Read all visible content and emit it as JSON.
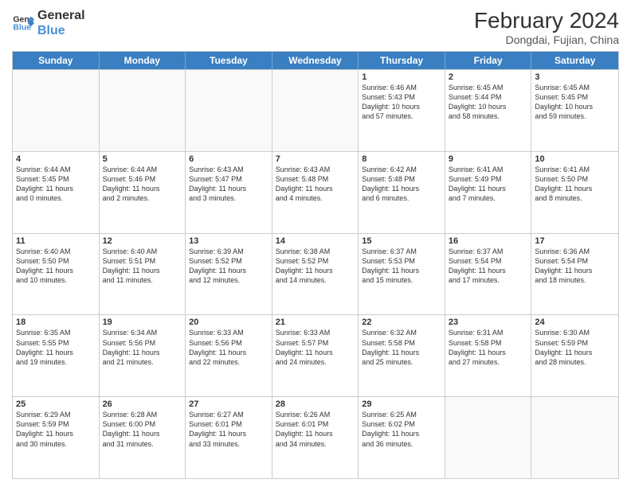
{
  "header": {
    "logo_line1": "General",
    "logo_line2": "Blue",
    "month_year": "February 2024",
    "location": "Dongdai, Fujian, China"
  },
  "weekdays": [
    "Sunday",
    "Monday",
    "Tuesday",
    "Wednesday",
    "Thursday",
    "Friday",
    "Saturday"
  ],
  "rows": [
    [
      {
        "day": "",
        "info": ""
      },
      {
        "day": "",
        "info": ""
      },
      {
        "day": "",
        "info": ""
      },
      {
        "day": "",
        "info": ""
      },
      {
        "day": "1",
        "info": "Sunrise: 6:46 AM\nSunset: 5:43 PM\nDaylight: 10 hours\nand 57 minutes."
      },
      {
        "day": "2",
        "info": "Sunrise: 6:45 AM\nSunset: 5:44 PM\nDaylight: 10 hours\nand 58 minutes."
      },
      {
        "day": "3",
        "info": "Sunrise: 6:45 AM\nSunset: 5:45 PM\nDaylight: 10 hours\nand 59 minutes."
      }
    ],
    [
      {
        "day": "4",
        "info": "Sunrise: 6:44 AM\nSunset: 5:45 PM\nDaylight: 11 hours\nand 0 minutes."
      },
      {
        "day": "5",
        "info": "Sunrise: 6:44 AM\nSunset: 5:46 PM\nDaylight: 11 hours\nand 2 minutes."
      },
      {
        "day": "6",
        "info": "Sunrise: 6:43 AM\nSunset: 5:47 PM\nDaylight: 11 hours\nand 3 minutes."
      },
      {
        "day": "7",
        "info": "Sunrise: 6:43 AM\nSunset: 5:48 PM\nDaylight: 11 hours\nand 4 minutes."
      },
      {
        "day": "8",
        "info": "Sunrise: 6:42 AM\nSunset: 5:48 PM\nDaylight: 11 hours\nand 6 minutes."
      },
      {
        "day": "9",
        "info": "Sunrise: 6:41 AM\nSunset: 5:49 PM\nDaylight: 11 hours\nand 7 minutes."
      },
      {
        "day": "10",
        "info": "Sunrise: 6:41 AM\nSunset: 5:50 PM\nDaylight: 11 hours\nand 8 minutes."
      }
    ],
    [
      {
        "day": "11",
        "info": "Sunrise: 6:40 AM\nSunset: 5:50 PM\nDaylight: 11 hours\nand 10 minutes."
      },
      {
        "day": "12",
        "info": "Sunrise: 6:40 AM\nSunset: 5:51 PM\nDaylight: 11 hours\nand 11 minutes."
      },
      {
        "day": "13",
        "info": "Sunrise: 6:39 AM\nSunset: 5:52 PM\nDaylight: 11 hours\nand 12 minutes."
      },
      {
        "day": "14",
        "info": "Sunrise: 6:38 AM\nSunset: 5:52 PM\nDaylight: 11 hours\nand 14 minutes."
      },
      {
        "day": "15",
        "info": "Sunrise: 6:37 AM\nSunset: 5:53 PM\nDaylight: 11 hours\nand 15 minutes."
      },
      {
        "day": "16",
        "info": "Sunrise: 6:37 AM\nSunset: 5:54 PM\nDaylight: 11 hours\nand 17 minutes."
      },
      {
        "day": "17",
        "info": "Sunrise: 6:36 AM\nSunset: 5:54 PM\nDaylight: 11 hours\nand 18 minutes."
      }
    ],
    [
      {
        "day": "18",
        "info": "Sunrise: 6:35 AM\nSunset: 5:55 PM\nDaylight: 11 hours\nand 19 minutes."
      },
      {
        "day": "19",
        "info": "Sunrise: 6:34 AM\nSunset: 5:56 PM\nDaylight: 11 hours\nand 21 minutes."
      },
      {
        "day": "20",
        "info": "Sunrise: 6:33 AM\nSunset: 5:56 PM\nDaylight: 11 hours\nand 22 minutes."
      },
      {
        "day": "21",
        "info": "Sunrise: 6:33 AM\nSunset: 5:57 PM\nDaylight: 11 hours\nand 24 minutes."
      },
      {
        "day": "22",
        "info": "Sunrise: 6:32 AM\nSunset: 5:58 PM\nDaylight: 11 hours\nand 25 minutes."
      },
      {
        "day": "23",
        "info": "Sunrise: 6:31 AM\nSunset: 5:58 PM\nDaylight: 11 hours\nand 27 minutes."
      },
      {
        "day": "24",
        "info": "Sunrise: 6:30 AM\nSunset: 5:59 PM\nDaylight: 11 hours\nand 28 minutes."
      }
    ],
    [
      {
        "day": "25",
        "info": "Sunrise: 6:29 AM\nSunset: 5:59 PM\nDaylight: 11 hours\nand 30 minutes."
      },
      {
        "day": "26",
        "info": "Sunrise: 6:28 AM\nSunset: 6:00 PM\nDaylight: 11 hours\nand 31 minutes."
      },
      {
        "day": "27",
        "info": "Sunrise: 6:27 AM\nSunset: 6:01 PM\nDaylight: 11 hours\nand 33 minutes."
      },
      {
        "day": "28",
        "info": "Sunrise: 6:26 AM\nSunset: 6:01 PM\nDaylight: 11 hours\nand 34 minutes."
      },
      {
        "day": "29",
        "info": "Sunrise: 6:25 AM\nSunset: 6:02 PM\nDaylight: 11 hours\nand 36 minutes."
      },
      {
        "day": "",
        "info": ""
      },
      {
        "day": "",
        "info": ""
      }
    ]
  ]
}
